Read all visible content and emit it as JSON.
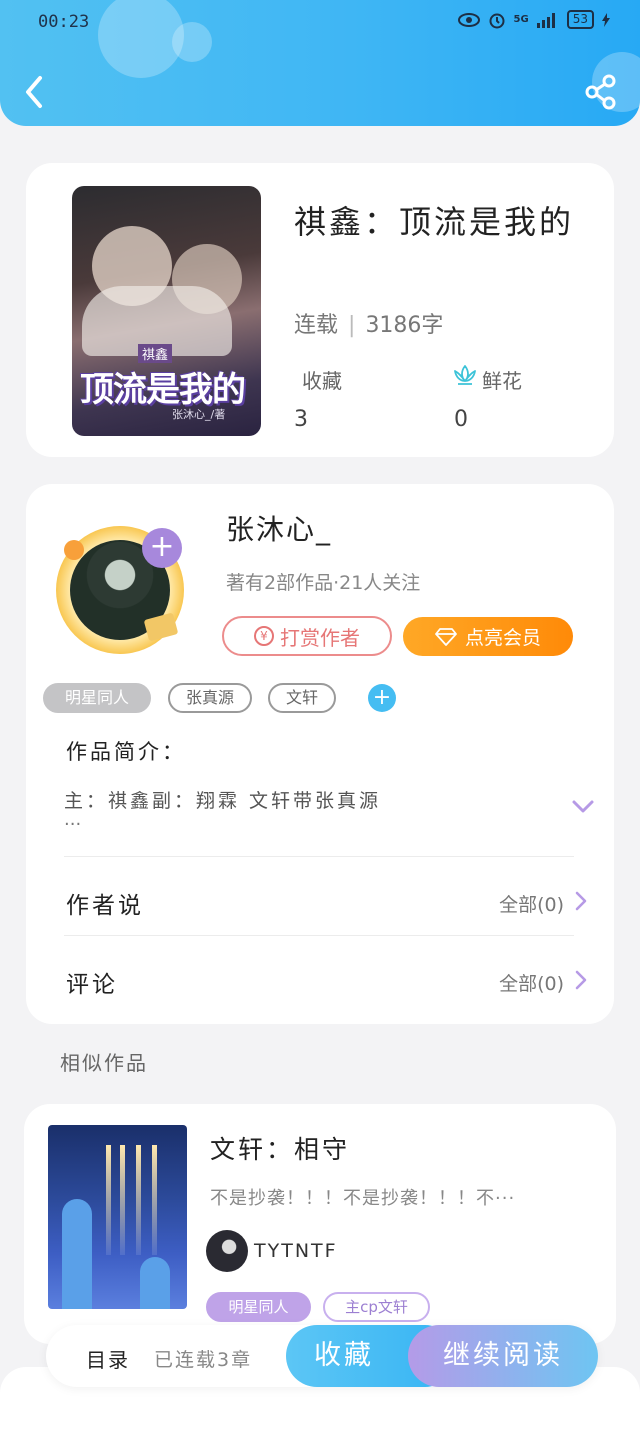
{
  "status_bar": {
    "time": "00:23",
    "network": "5G",
    "battery": "53"
  },
  "book": {
    "title": "祺鑫：顶流是我的",
    "status": "连载",
    "word_count": "3186字",
    "cover": {
      "tag": "祺鑫",
      "title": "顶流是我的",
      "author": "张沐心_/著"
    },
    "favorites_label": "收藏",
    "favorites_value": "3",
    "flowers_label": "鲜花",
    "flowers_value": "0"
  },
  "author": {
    "name": "张沐心_",
    "meta": "著有2部作品·21人关注",
    "tip_label": "打赏作者",
    "vip_label": "点亮会员"
  },
  "tags": [
    "明星同人",
    "张真源",
    "文轩"
  ],
  "intro": {
    "title": "作品简介：",
    "text": "主：祺鑫副：翔霖 文轩带张真源",
    "more": "···"
  },
  "rows": [
    {
      "label": "作者说",
      "value": "全部(0)"
    },
    {
      "label": "评论",
      "value": "全部(0)"
    }
  ],
  "similar": {
    "section_title": "相似作品",
    "item": {
      "title": "文轩：相守",
      "desc": "不是抄袭！！！不是抄袭！！！不···",
      "author": "TYTNTF",
      "tags": [
        "明星同人",
        "主cp文轩"
      ]
    }
  },
  "bottom_bar": {
    "toc_label": "目录",
    "toc_count": "已连载3章",
    "favorite_label": "收藏",
    "read_label": "继续阅读"
  },
  "colors": {
    "accent_blue": "#3fb6f4",
    "accent_purple": "#a788dc",
    "vip_orange": "#ff9514",
    "tip_red": "#e67676"
  }
}
